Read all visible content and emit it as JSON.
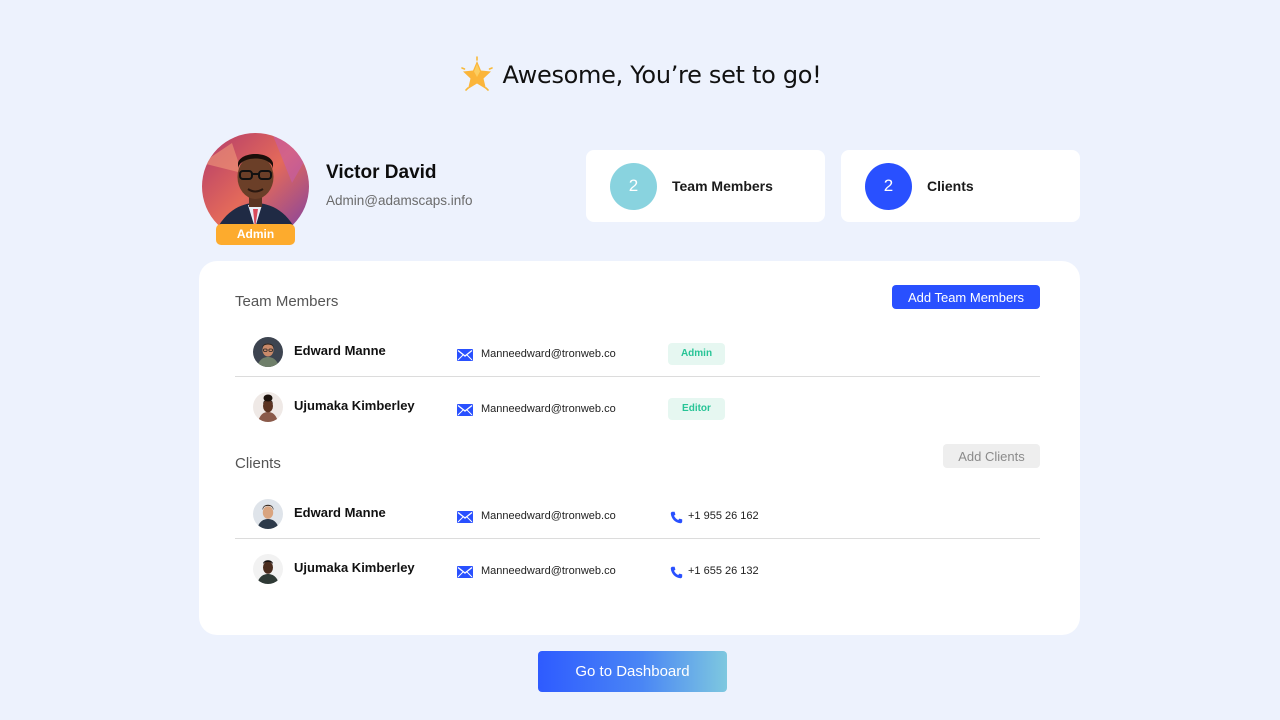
{
  "header": {
    "title": "Awesome, You’re set to go!",
    "icon": "star-icon"
  },
  "profile": {
    "name": "Victor David",
    "email": "Admin@adamscaps.info",
    "role_badge": "Admin"
  },
  "stats": [
    {
      "count": "2",
      "label": "Team Members",
      "color": "#89d3df"
    },
    {
      "count": "2",
      "label": "Clients",
      "color": "#2950ff"
    }
  ],
  "team_section": {
    "title": "Team Members",
    "add_button": "Add Team Members",
    "rows": [
      {
        "name": "Edward Manne",
        "email": "Manneedward@tronweb.co",
        "role": "Admin"
      },
      {
        "name": "Ujumaka Kimberley",
        "email": "Manneedward@tronweb.co",
        "role": "Editor"
      }
    ]
  },
  "clients_section": {
    "title": "Clients",
    "add_button": "Add Clients",
    "rows": [
      {
        "name": "Edward Manne",
        "email": "Manneedward@tronweb.co",
        "phone": "+1 955 26 162"
      },
      {
        "name": "Ujumaka Kimberley",
        "email": "Manneedward@tronweb.co",
        "phone": "+1 655 26 132"
      }
    ]
  },
  "footer": {
    "dashboard_button": "Go to Dashboard"
  },
  "colors": {
    "primary": "#2950ff",
    "badge": "#fdab2d",
    "role_text": "#27c496",
    "background": "#edf2fd"
  }
}
